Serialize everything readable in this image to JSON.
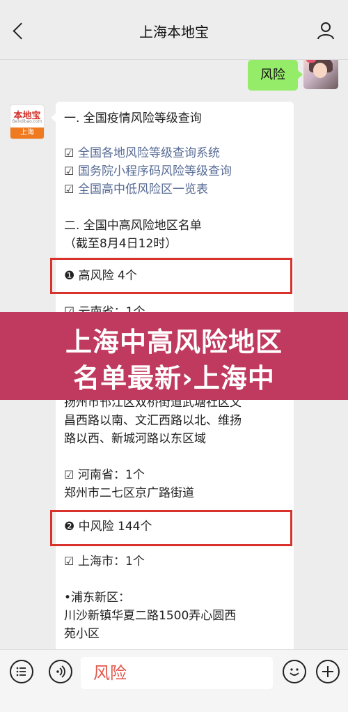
{
  "header": {
    "title": "上海本地宝",
    "back_icon": "chevron-left-icon",
    "profile_icon": "person-icon"
  },
  "messages": {
    "user_message": "风险",
    "bot_avatar": {
      "logo_text": "本地宝",
      "logo_url": "Bendibao.com",
      "city": "上海"
    }
  },
  "bot_reply": {
    "section1_title": "一. 全国疫情风险等级查询",
    "links": [
      "全国各地风险等级查询系统",
      "国务院小程序码风险等级查询",
      "全国高中低风险区一览表"
    ],
    "section2_title": "二. 全国中高风险地区名单",
    "section2_date": "（截至8月4日12时）",
    "high_risk_label": "❶ 高风险 4个",
    "partial_hidden_line": "☑ 云南省：1个",
    "yangzhou_lines": [
      "扬州市邗江区双桥街道武塘社区文",
      "昌西路以南、文汇西路以北、维扬",
      "路以西、新城河路以东区域"
    ],
    "henan_label": "河南省：1个",
    "henan_detail": "郑州市二七区京广路街道",
    "mid_risk_label": "❷ 中风险 144个",
    "shanghai_label": "上海市：1个",
    "pudong_label": "•浦东新区：",
    "pudong_lines": [
      "川沙新镇华夏二路1500弄心圆西",
      "苑小区"
    ]
  },
  "banner": {
    "line1": "上海中高风险地区",
    "line2": "名单最新›上海中",
    "color": "#c0395e"
  },
  "bottom_bar": {
    "input_value": "风险",
    "menu_icon": "menu-list-icon",
    "voice_icon": "voice-icon",
    "emoji_icon": "emoji-icon",
    "add_icon": "plus-icon"
  }
}
